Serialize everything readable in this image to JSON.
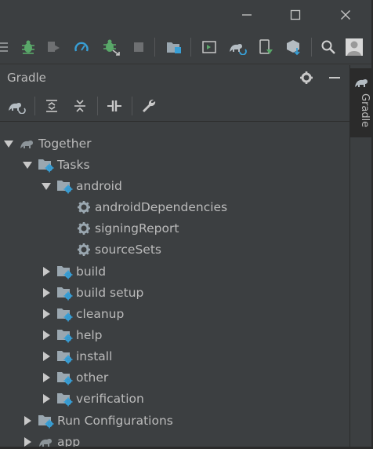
{
  "panel": {
    "title": "Gradle"
  },
  "side_strip": {
    "tab_label": "Gradle"
  },
  "tree": [
    {
      "label": "Together",
      "icon": "elephant-icon",
      "expanded": true
    },
    {
      "label": "Tasks",
      "icon": "task-folder-icon",
      "expanded": true
    },
    {
      "label": "android",
      "icon": "task-folder-icon",
      "expanded": true
    },
    {
      "label": "androidDependencies",
      "icon": "gear-icon"
    },
    {
      "label": "signingReport",
      "icon": "gear-icon"
    },
    {
      "label": "sourceSets",
      "icon": "gear-icon"
    },
    {
      "label": "build",
      "icon": "task-folder-icon",
      "expanded": false
    },
    {
      "label": "build setup",
      "icon": "task-folder-icon",
      "expanded": false
    },
    {
      "label": "cleanup",
      "icon": "task-folder-icon",
      "expanded": false
    },
    {
      "label": "help",
      "icon": "task-folder-icon",
      "expanded": false
    },
    {
      "label": "install",
      "icon": "task-folder-icon",
      "expanded": false
    },
    {
      "label": "other",
      "icon": "task-folder-icon",
      "expanded": false
    },
    {
      "label": "verification",
      "icon": "task-folder-icon",
      "expanded": false
    },
    {
      "label": "Run Configurations",
      "icon": "task-folder-icon",
      "expanded": false
    },
    {
      "label": "app",
      "icon": "elephant-icon",
      "expanded": false
    }
  ],
  "colors": {
    "background": "#3c3f41",
    "text": "#bbbbbb",
    "icon_green": "#59a869",
    "icon_blue": "#389fd6",
    "folder": "#9aa7b0"
  }
}
